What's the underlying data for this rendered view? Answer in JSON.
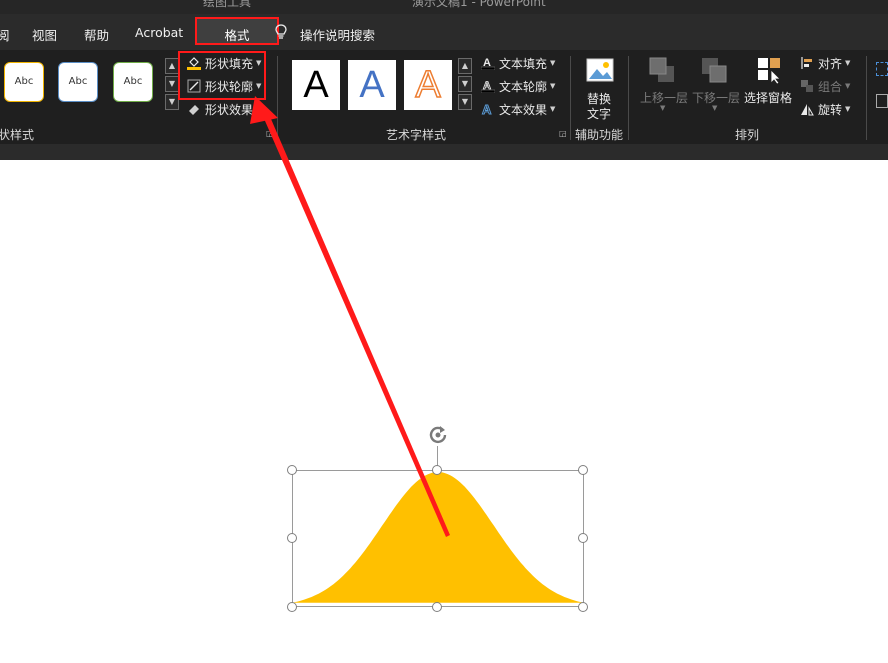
{
  "titlebar": {
    "context_tab": "绘图工具",
    "doc_title": "演示文稿1  -  PowerPoint"
  },
  "tabs": {
    "review_partial": "阅",
    "view": "视图",
    "help": "帮助",
    "acrobat": "Acrobat",
    "format": "格式",
    "tell_me": "操作说明搜索"
  },
  "shape_styles": {
    "group_label": "状样式",
    "preview_text": "Abc",
    "fill": "形状填充",
    "outline": "形状轮廓",
    "effects": "形状效果"
  },
  "wordart": {
    "group_label": "艺术字样式",
    "sample_letter": "A",
    "text_fill": "文本填充",
    "text_outline": "文本轮廓",
    "text_effects": "文本效果"
  },
  "accessibility": {
    "group_label": "辅助功能",
    "alt_text_line1": "替换",
    "alt_text_line2": "文字"
  },
  "arrange": {
    "group_label": "排列",
    "bring_forward": "上移一层",
    "send_backward": "下移一层",
    "selection_pane": "选择窗格",
    "align": "对齐",
    "group": "组合",
    "rotate": "旋转"
  },
  "colors": {
    "shape_fill": "#FFC000",
    "highlight": "#FF1A1A",
    "ribbon_bg": "#1F1F1F",
    "tab_bg": "#2B2B2B"
  },
  "icons": [
    "paint-bucket-icon",
    "pen-outline-icon",
    "shape-effects-icon",
    "text-fill-icon",
    "text-outline-icon",
    "text-effects-icon",
    "alt-text-icon",
    "bring-forward-icon",
    "send-backward-icon",
    "selection-pane-icon",
    "align-icon",
    "group-icon",
    "rotate-icon",
    "rotation-handle-icon"
  ]
}
